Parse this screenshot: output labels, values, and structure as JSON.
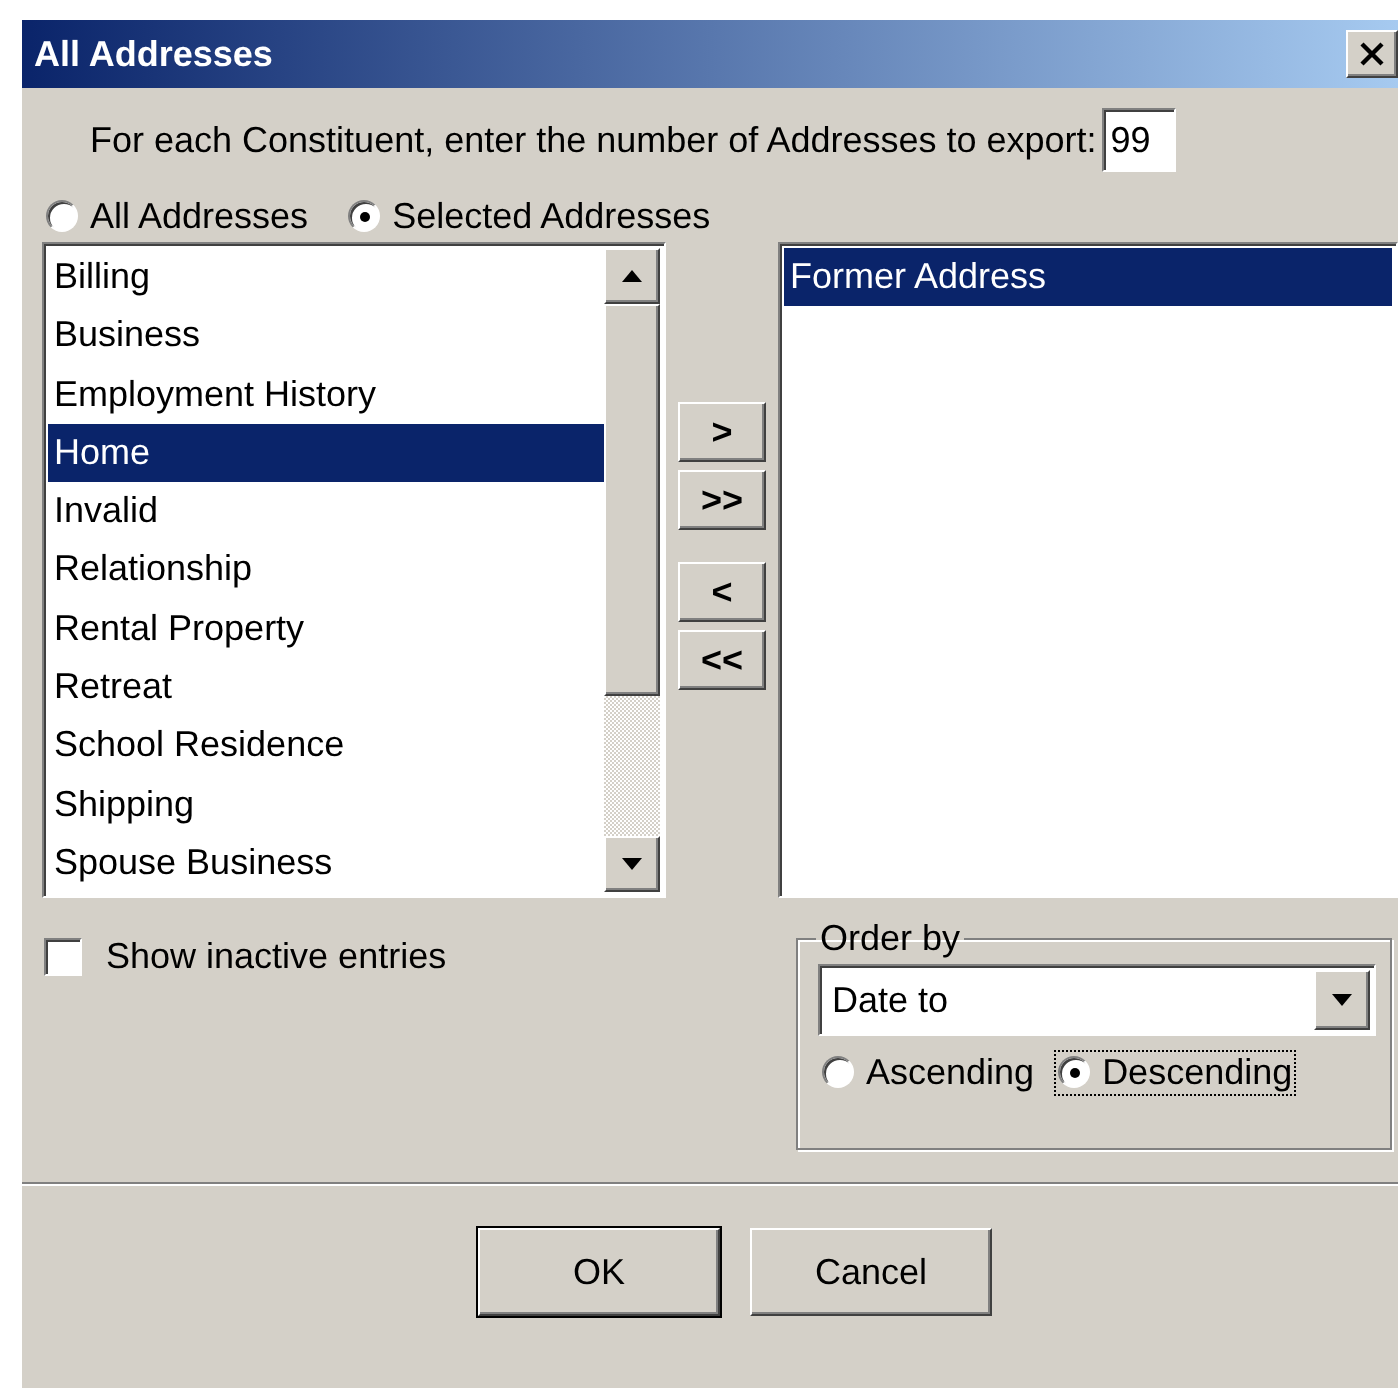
{
  "window": {
    "title": "All Addresses"
  },
  "export_count": {
    "label": "For each Constituent, enter the number of Addresses to export:",
    "value": "99"
  },
  "scope_options": [
    {
      "label": "All Addresses",
      "selected": false
    },
    {
      "label": "Selected Addresses",
      "selected": true
    }
  ],
  "available": {
    "items": [
      {
        "label": "Billing",
        "selected": false
      },
      {
        "label": "Business",
        "selected": false
      },
      {
        "label": "Employment History",
        "selected": false
      },
      {
        "label": "Home",
        "selected": true
      },
      {
        "label": "Invalid",
        "selected": false
      },
      {
        "label": "Relationship",
        "selected": false
      },
      {
        "label": "Rental Property",
        "selected": false
      },
      {
        "label": "Retreat",
        "selected": false
      },
      {
        "label": "School Residence",
        "selected": false
      },
      {
        "label": "Shipping",
        "selected": false
      },
      {
        "label": "Spouse Business",
        "selected": false
      }
    ]
  },
  "move_buttons": [
    ">",
    ">>",
    "<",
    "<<"
  ],
  "chosen": {
    "items": [
      {
        "label": "Former Address",
        "selected": true
      }
    ]
  },
  "show_inactive": {
    "label": "Show inactive entries",
    "checked": false
  },
  "order_by": {
    "title": "Order by",
    "value": "Date to",
    "directions": [
      {
        "label": "Ascending",
        "selected": false,
        "focused": false
      },
      {
        "label": "Descending",
        "selected": true,
        "focused": true
      }
    ]
  },
  "buttons": [
    "OK",
    "Cancel"
  ]
}
